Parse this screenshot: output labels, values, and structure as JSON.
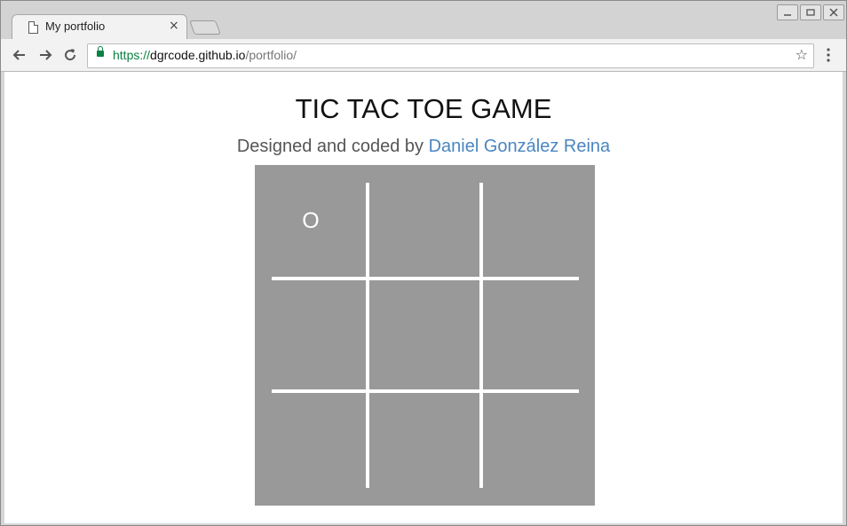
{
  "browser": {
    "tab_title": "My portfolio",
    "tab_close": "×",
    "url_scheme": "https://",
    "url_host": "dgrcode.github.io",
    "url_path": "/portfolio/",
    "icons": [
      "page-icon",
      "close-icon",
      "back-icon",
      "forward-icon",
      "reload-icon",
      "lock-icon",
      "bookmark-star-icon",
      "menu-icon",
      "minimize-icon",
      "restore-icon",
      "window-close-icon"
    ]
  },
  "page": {
    "title": "TIC TAC TOE GAME",
    "subtitle_prefix": "Designed and coded by ",
    "author": "Daniel González Reina",
    "colors": {
      "board": "#999999",
      "link": "#4a86c0",
      "lines": "#ffffff"
    }
  },
  "board": {
    "cells": [
      "O",
      "",
      "",
      "",
      "",
      "",
      "",
      "",
      ""
    ]
  }
}
